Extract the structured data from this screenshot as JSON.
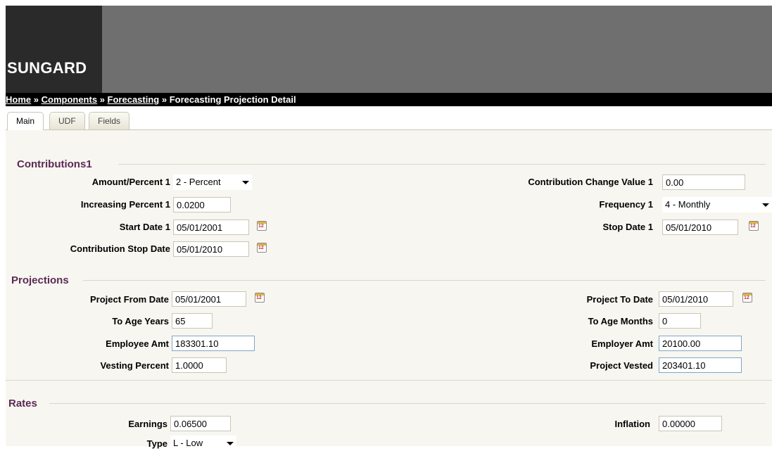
{
  "header": {
    "logo": "SUNGARD"
  },
  "breadcrumb": {
    "items": [
      "Home",
      "Components",
      "Forecasting"
    ],
    "current": "Forecasting Projection Detail",
    "separator": "»"
  },
  "tabs": [
    {
      "label": "Main",
      "active": true
    },
    {
      "label": "UDF",
      "active": false
    },
    {
      "label": "Fields",
      "active": false
    }
  ],
  "contributions": {
    "title": "Contributions1",
    "amount_percent": {
      "label": "Amount/Percent 1",
      "value": "2 - Percent"
    },
    "increasing_percent": {
      "label": "Increasing Percent 1",
      "value": "0.0200"
    },
    "start_date": {
      "label": "Start Date 1",
      "value": "05/01/2001"
    },
    "stop_date_contrib": {
      "label": "Contribution Stop Date",
      "value": "05/01/2010"
    },
    "change_value": {
      "label": "Contribution Change Value 1",
      "value": "0.00"
    },
    "frequency": {
      "label": "Frequency 1",
      "value": "4 - Monthly"
    },
    "stop_date": {
      "label": "Stop Date 1",
      "value": "05/01/2010"
    }
  },
  "projections": {
    "title": "Projections",
    "project_from": {
      "label": "Project From Date",
      "value": "05/01/2001"
    },
    "to_age_years": {
      "label": "To Age Years",
      "value": "65"
    },
    "employee_amt": {
      "label": "Employee Amt",
      "value": "183301.10"
    },
    "vesting_percent": {
      "label": "Vesting Percent",
      "value": "1.0000"
    },
    "project_to": {
      "label": "Project To Date",
      "value": "05/01/2010"
    },
    "to_age_months": {
      "label": "To Age Months",
      "value": "0"
    },
    "employer_amt": {
      "label": "Employer Amt",
      "value": "20100.00"
    },
    "project_vested": {
      "label": "Project Vested",
      "value": "203401.10"
    }
  },
  "rates": {
    "title": "Rates",
    "earnings": {
      "label": "Earnings",
      "value": "0.06500"
    },
    "type": {
      "label": "Type",
      "value": "L - Low"
    },
    "inflation": {
      "label": "Inflation",
      "value": "0.00000"
    }
  },
  "calendar_icon_number": "12"
}
